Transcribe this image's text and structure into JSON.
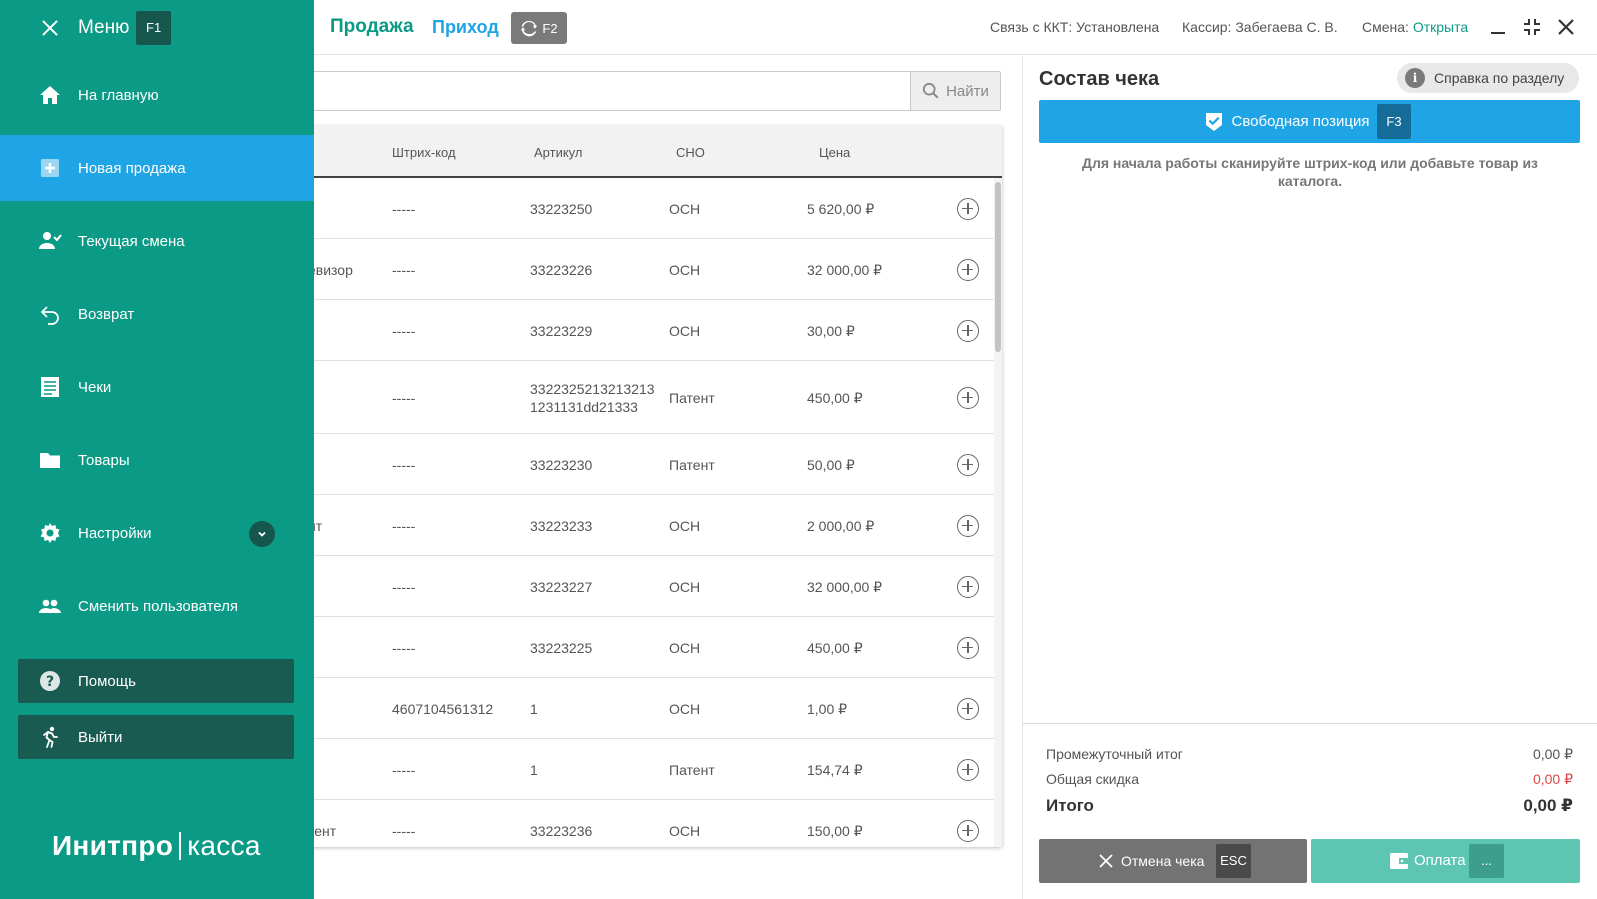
{
  "sidebar": {
    "menu_title": "Меню",
    "menu_key": "F1",
    "items": [
      {
        "label": "На главную",
        "icon": "home-icon"
      },
      {
        "label": "Новая продажа",
        "icon": "plus-square-icon"
      },
      {
        "label": "Текущая смена",
        "icon": "cashier-person-icon"
      },
      {
        "label": "Возврат",
        "icon": "return-arrow-icon"
      },
      {
        "label": "Чеки",
        "icon": "receipt-list-icon"
      },
      {
        "label": "Товары",
        "icon": "folder-icon"
      },
      {
        "label": "Настройки",
        "icon": "gear-icon"
      },
      {
        "label": "Сменить пользователя",
        "icon": "users-icon"
      }
    ],
    "help_label": "Помощь",
    "logout_label": "Выйти",
    "brand_left": "Инитпро",
    "brand_right": "касса"
  },
  "header": {
    "tab_sale": "Продажа",
    "tab_income": "Приход",
    "refresh_key": "F2",
    "kkt_label": "Связь с ККТ: Установлена",
    "cashier_label": "Кассир: Забегаева С. В.",
    "shift_label": "Смена:",
    "shift_value": "Открыта"
  },
  "search": {
    "value": "",
    "placeholder": "",
    "button_label": "Найти"
  },
  "table": {
    "columns": [
      "Штрих-код",
      "Артикул",
      "СНО",
      "Цена"
    ],
    "rows": [
      {
        "name": "",
        "barcode": "-----",
        "article": "33223250",
        "sno": "ОСН",
        "price": "5 620,00 ₽"
      },
      {
        "name": "евизор",
        "barcode": "-----",
        "article": "33223226",
        "sno": "ОСН",
        "price": "32 000,00 ₽"
      },
      {
        "name": "",
        "barcode": "-----",
        "article": "33223229",
        "sno": "ОСН",
        "price": "30,00 ₽"
      },
      {
        "name": "",
        "barcode": "-----",
        "article": "3322325213213213 1231131dd21333",
        "sno": "Патент",
        "price": "450,00 ₽"
      },
      {
        "name": "",
        "barcode": "-----",
        "article": "33223230",
        "sno": "Патент",
        "price": "50,00 ₽"
      },
      {
        "name": "нт",
        "barcode": "-----",
        "article": "33223233",
        "sno": "ОСН",
        "price": "2 000,00 ₽"
      },
      {
        "name": "",
        "barcode": "-----",
        "article": "33223227",
        "sno": "ОСН",
        "price": "32 000,00 ₽"
      },
      {
        "name": "",
        "barcode": "-----",
        "article": "33223225",
        "sno": "ОСН",
        "price": "450,00 ₽"
      },
      {
        "name": "",
        "barcode": "4607104561312",
        "article": "1",
        "sno": "ОСН",
        "price": "1,00 ₽"
      },
      {
        "name": "",
        "barcode": "-----",
        "article": "1",
        "sno": "Патент",
        "price": "154,74 ₽"
      },
      {
        "name": "тент",
        "barcode": "-----",
        "article": "33223236",
        "sno": "ОСН",
        "price": "150,00 ₽"
      }
    ]
  },
  "receipt": {
    "title": "Состав чека",
    "help_label": "Справка по разделу",
    "free_position_label": "Свободная позиция",
    "free_position_key": "F3",
    "hint": "Для начала работы сканируйте штрих-код или добавьте товар из каталога.",
    "subtotal_label": "Промежуточный итог",
    "subtotal_value": "0,00 ₽",
    "discount_label": "Общая скидка",
    "discount_value": "0,00 ₽",
    "total_label": "Итого",
    "total_value": "0,00 ₽",
    "cancel_label": "Отмена чека",
    "cancel_key": "ESC",
    "pay_label": "Оплата",
    "pay_key": "..."
  },
  "colors": {
    "sidebar_bg": "#0b9a86",
    "accent_blue": "#1fa4e6",
    "accent_green": "#0b9a86",
    "pay_button": "#5dc6b2",
    "discount_red": "#e04444"
  }
}
